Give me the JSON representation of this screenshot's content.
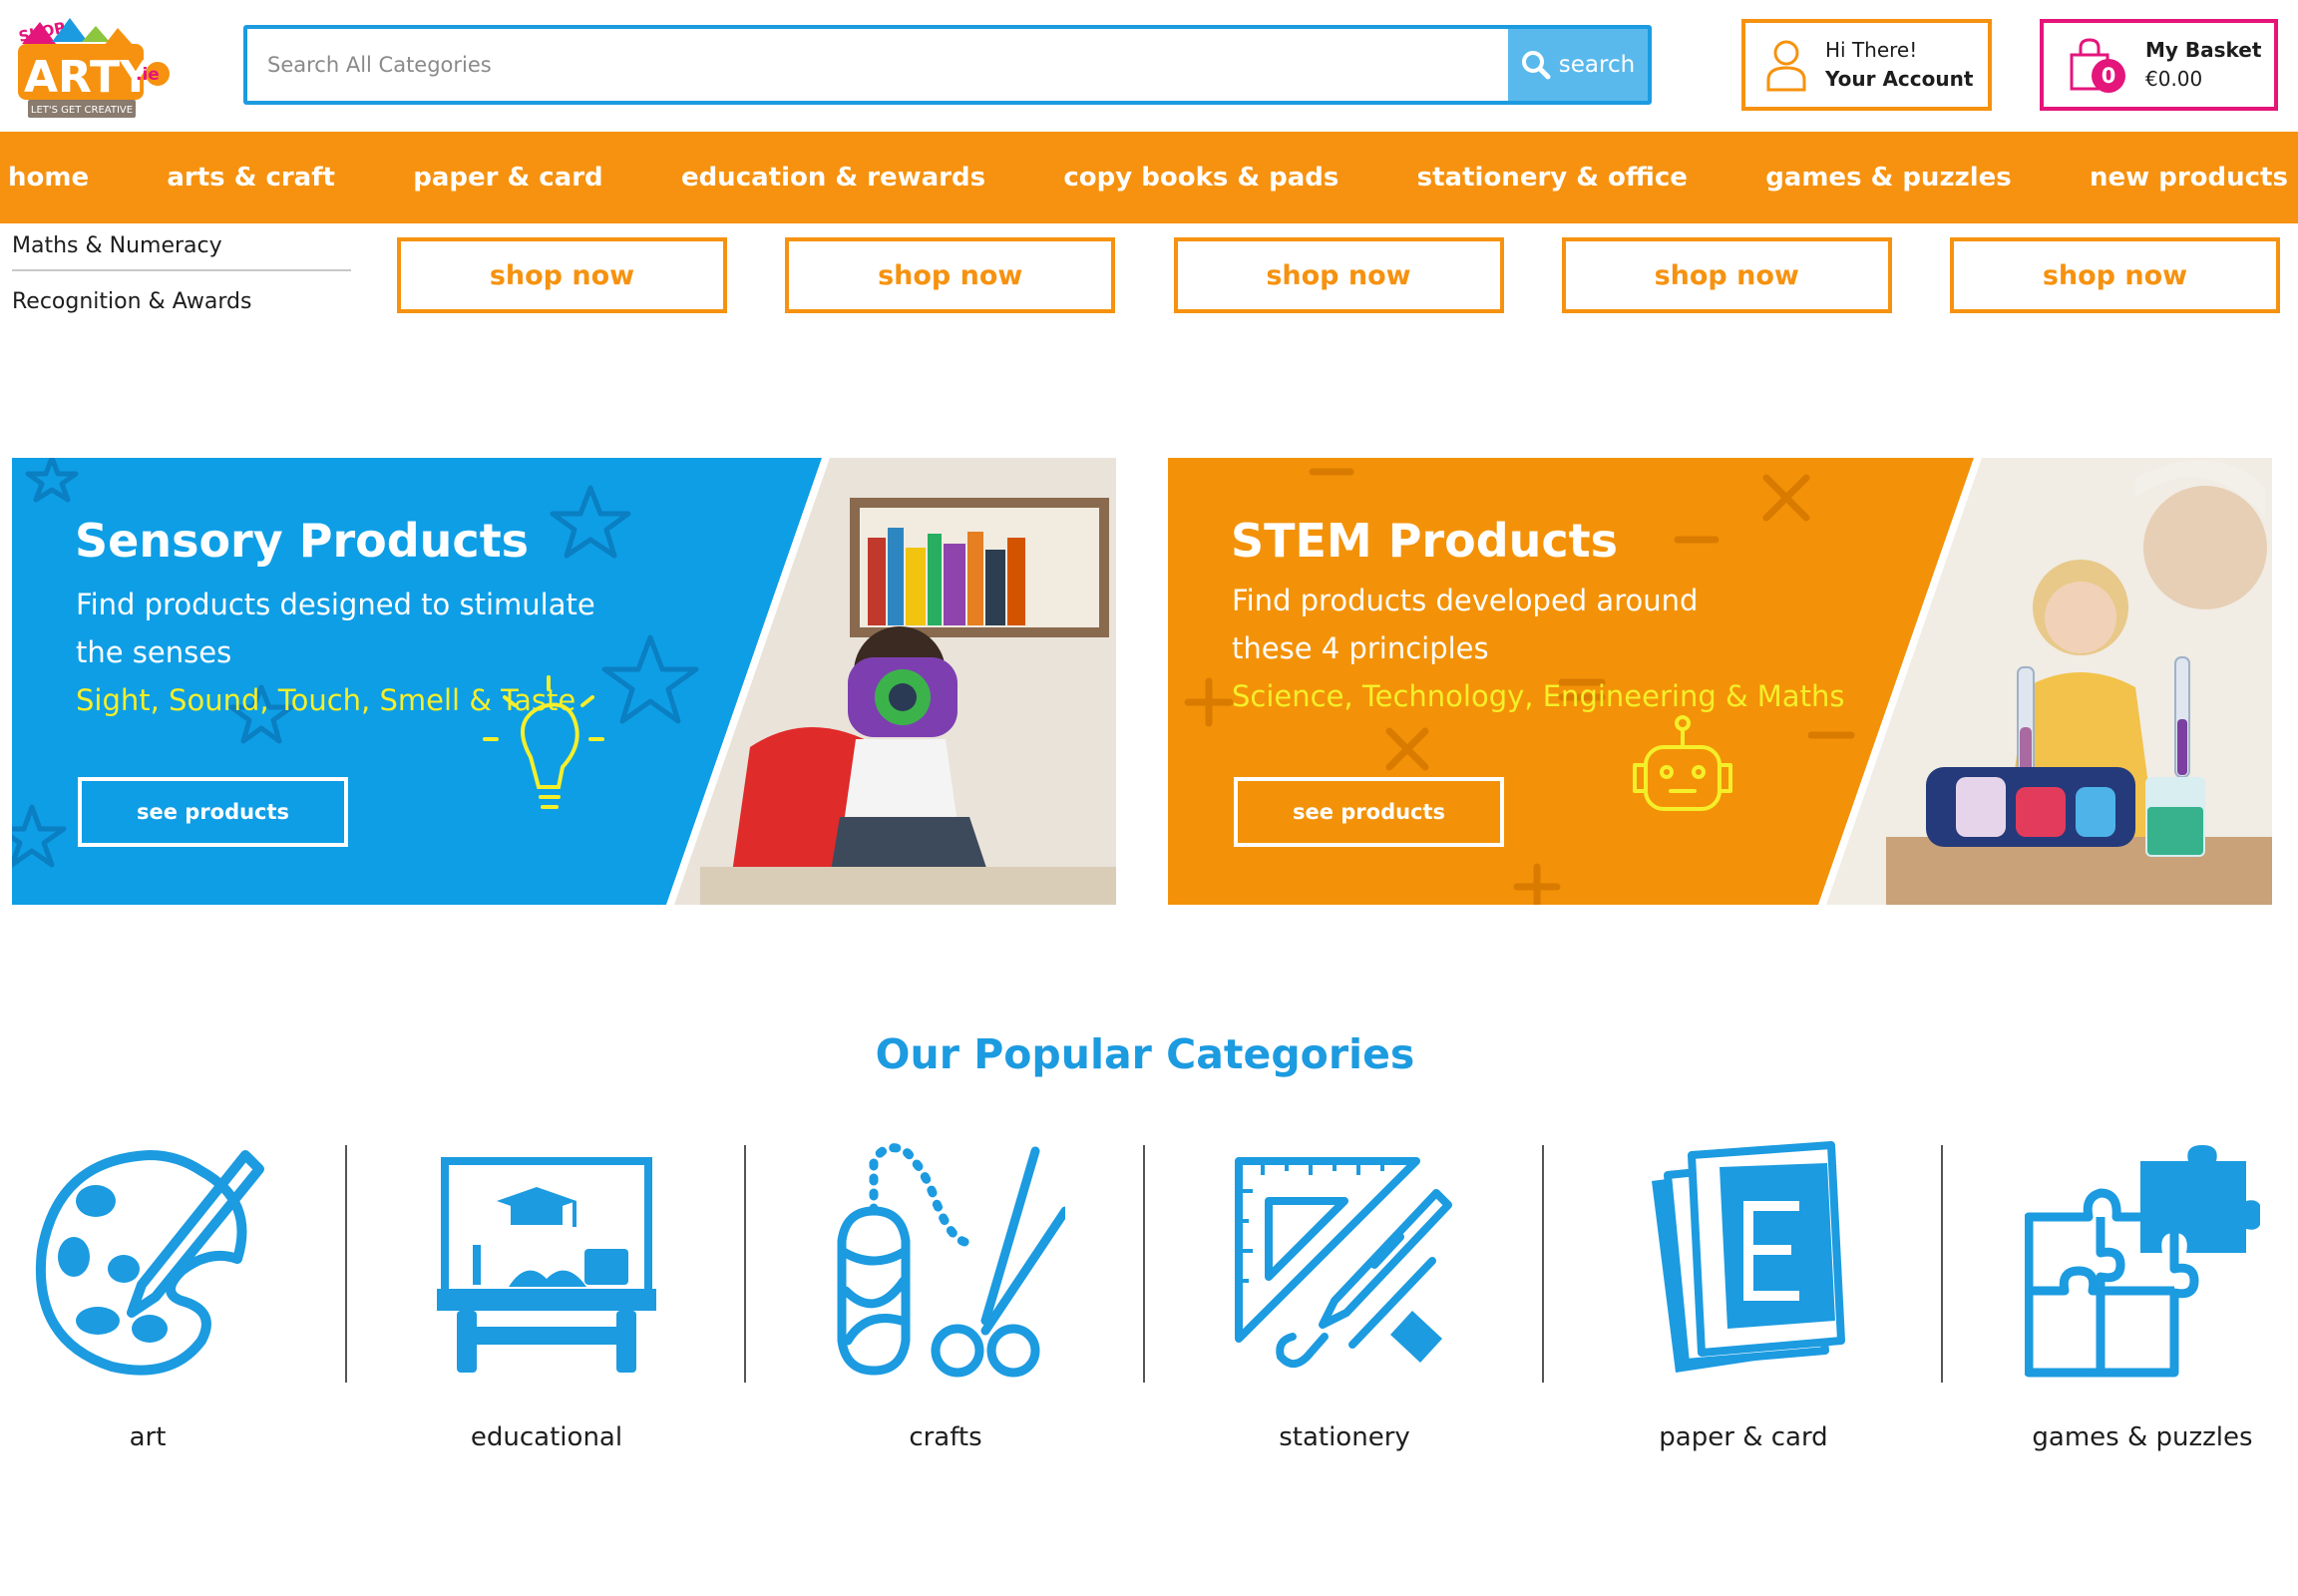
{
  "header": {
    "logo": {
      "alt": "shop arty.ie logo",
      "text_shop": "SHOP",
      "text_arty": "ARTY",
      "text_ie": ".ie",
      "tagline": "LET'S GET CREATIVE"
    },
    "search": {
      "placeholder": "Search All Categories",
      "value": "",
      "button_label": "search"
    },
    "account": {
      "greeting": "Hi There!",
      "label": "Your Account"
    },
    "basket": {
      "label": "My Basket",
      "total": "€0.00",
      "count": "0"
    }
  },
  "nav": {
    "items": [
      "home",
      "arts & craft",
      "paper & card",
      "education & rewards",
      "copy books & pads",
      "stationery & office",
      "games & puzzles",
      "new products"
    ]
  },
  "submenu": {
    "items": [
      "Maths & Numeracy",
      "Recognition & Awards"
    ],
    "shop_buttons": [
      "shop now",
      "shop now",
      "shop now",
      "shop now",
      "shop now"
    ]
  },
  "banners": {
    "sensory": {
      "title": "Sensory Products",
      "line1": "Find products designed to stimulate",
      "line2": "the senses",
      "highlight": "Sight, Sound, Touch, Smell & Taste",
      "button": "see products"
    },
    "stem": {
      "title": "STEM Products",
      "line1": "Find products developed around",
      "line2": "these 4 principles",
      "highlight": "Science, Technology, Engineering & Maths",
      "button": "see products"
    }
  },
  "categories": {
    "heading": "Our Popular Categories",
    "items": [
      {
        "label": "art",
        "icon": "palette-icon"
      },
      {
        "label": "educational",
        "icon": "classroom-desk-icon"
      },
      {
        "label": "crafts",
        "icon": "yarn-scissors-icon"
      },
      {
        "label": "stationery",
        "icon": "ruler-pencil-icon"
      },
      {
        "label": "paper & card",
        "icon": "paper-stack-icon"
      },
      {
        "label": "games & puzzles",
        "icon": "puzzle-icon"
      }
    ]
  },
  "colors": {
    "brand_orange": "#f6920f",
    "brand_blue": "#1c9be0",
    "brand_pink": "#e4157b",
    "highlight_yellow": "#f5ef2a"
  }
}
